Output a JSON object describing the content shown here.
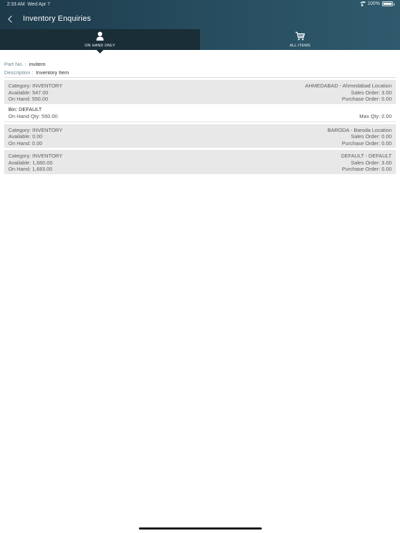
{
  "status_bar": {
    "time": "2:33 AM",
    "date": "Wed Apr 7",
    "battery": "100%",
    "battery_level": 1.0
  },
  "header": {
    "title": "Inventory Enquiries",
    "back_icon": "chevron-left-icon"
  },
  "tabs": [
    {
      "label": "ON HAND ONLY",
      "icon": "user-icon",
      "active": true
    },
    {
      "label": "ALL ITEMS",
      "icon": "cart-icon",
      "active": false
    }
  ],
  "part": {
    "part_no_label": "Part No. :",
    "part_no_value": "invitem",
    "description_label": "Description :",
    "description_value": "Inventory Item"
  },
  "locations": [
    {
      "category": "Category: INVENTORY",
      "location": "AHMEDABAD - Ahmedabad Location",
      "available": "Available: 547.00",
      "sales_order": "Sales Order: 3.00",
      "on_hand": "On Hand: 550.00",
      "purchase_order": "Purchase Order: 0.00",
      "bin": {
        "title": "Bin: DEFAULT",
        "on_hand_qty": "On Hand Qty: 550.00",
        "max_qty": "Max Qty: 0.00"
      }
    },
    {
      "category": "Category: INVENTORY",
      "location": "BARODA - Baroda Location",
      "available": "Available: 0.00",
      "sales_order": "Sales Order: 0.00",
      "on_hand": "On Hand: 0.00",
      "purchase_order": "Purchase Order: 0.00"
    },
    {
      "category": "Category: INVENTORY",
      "location": "DEFAULT - DEFAULT",
      "available": "Available: 1,680.00",
      "sales_order": "Sales Order: 3.00",
      "on_hand": "On Hand: 1,683.00",
      "purchase_order": "Purchase Order: 0.00"
    }
  ]
}
